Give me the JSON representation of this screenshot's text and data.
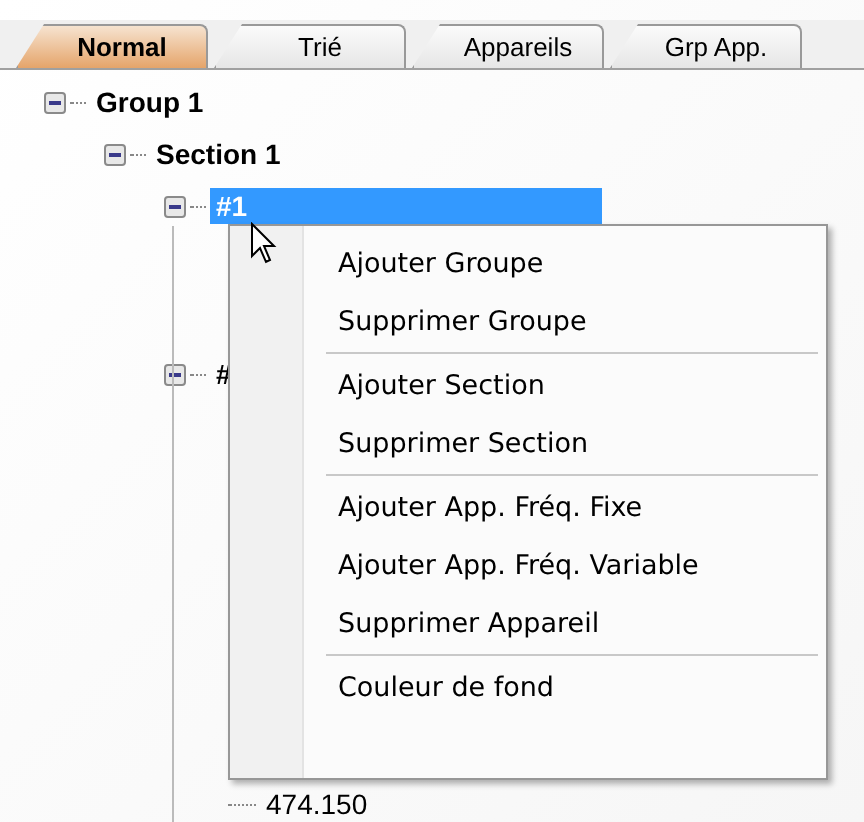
{
  "tabs": [
    {
      "label": "Normal",
      "selected": true
    },
    {
      "label": "Trié",
      "selected": false
    },
    {
      "label": "Appareils",
      "selected": false
    },
    {
      "label": "Grp App.",
      "selected": false
    }
  ],
  "tree": [
    {
      "label": "Group 1",
      "expanded": true,
      "selected": false,
      "children": [
        {
          "label": "Section 1",
          "expanded": true,
          "selected": false,
          "children": [
            {
              "label": "#1",
              "expanded": true,
              "selected": true
            },
            {
              "label": "#",
              "expanded": true,
              "selected": false,
              "children": [
                {
                  "label": "474.150",
                  "selected": false
                }
              ]
            }
          ]
        }
      ]
    }
  ],
  "context_menu": {
    "groups": [
      [
        "Ajouter Groupe",
        "Supprimer Groupe"
      ],
      [
        "Ajouter Section",
        "Supprimer Section"
      ],
      [
        "Ajouter App. Fréq. Fixe",
        "Ajouter App. Fréq. Variable",
        "Supprimer Appareil"
      ],
      [
        "Couleur de fond"
      ]
    ]
  }
}
